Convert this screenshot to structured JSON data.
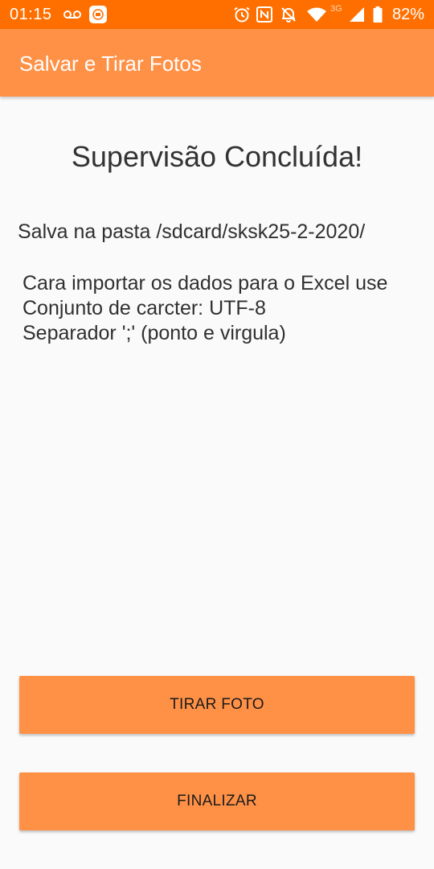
{
  "status_bar": {
    "time": "01:15",
    "network_type": "3G",
    "battery": "82%",
    "icons": [
      "voicemail-icon",
      "mi-app-icon",
      "alarm-icon",
      "nfc-icon",
      "notifications-off-icon",
      "wifi-icon",
      "signal-icon",
      "battery-icon"
    ],
    "color": "#ff6f00"
  },
  "app_bar": {
    "title": "Salvar e Tirar Fotos",
    "color": "#ff9147"
  },
  "content": {
    "headline": "Supervisão Concluída!",
    "saved_path": "Salva na pasta /sdcard/sksk25-2-2020/",
    "instructions": [
      "Cara importar os dados para o Excel use",
      "Conjunto de carcter: UTF-8",
      "Separador ';' (ponto e virgula)"
    ]
  },
  "buttons": {
    "take_photo": "TIRAR FOTO",
    "finish": "FINALIZAR",
    "color": "#ff9147"
  }
}
